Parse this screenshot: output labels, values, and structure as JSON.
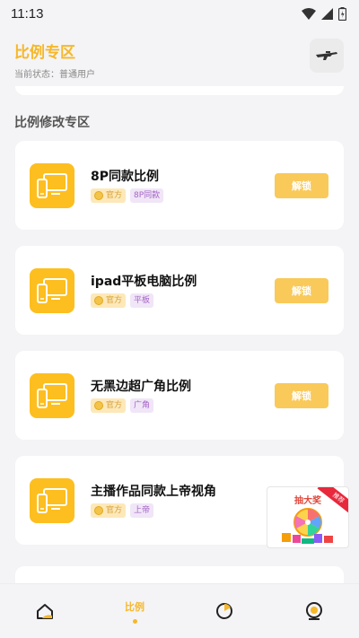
{
  "status_bar": {
    "time": "11:13"
  },
  "header": {
    "title": "比例专区",
    "subtitle": "当前状态：普通用户"
  },
  "section": {
    "title": "比例修改专区"
  },
  "cards": [
    {
      "title": "8P同款比例",
      "tag_official": "官方",
      "tag_sub": "8P同款",
      "button": "解锁"
    },
    {
      "title": "ipad平板电脑比例",
      "tag_official": "官方",
      "tag_sub": "平板",
      "button": "解锁"
    },
    {
      "title": "无黑边超广角比例",
      "tag_official": "官方",
      "tag_sub": "广角",
      "button": "解锁"
    },
    {
      "title": "主播作品同款上帝视角",
      "tag_official": "官方",
      "tag_sub": "上帝",
      "button": ""
    }
  ],
  "promo": {
    "text": "抽大奖",
    "ribbon": "推荐"
  },
  "bottom_nav": {
    "items": [
      {
        "label": "",
        "icon": "home-icon"
      },
      {
        "label": "比例",
        "icon": "ratio-icon",
        "active": true
      },
      {
        "label": "",
        "icon": "pie-chart-icon"
      },
      {
        "label": "",
        "icon": "profile-icon"
      }
    ]
  },
  "colors": {
    "accent": "#f6b72a",
    "icon_bg": "#fdbe1f",
    "unlock": "#f9c95a",
    "tag_sub_text": "#a665c7"
  }
}
